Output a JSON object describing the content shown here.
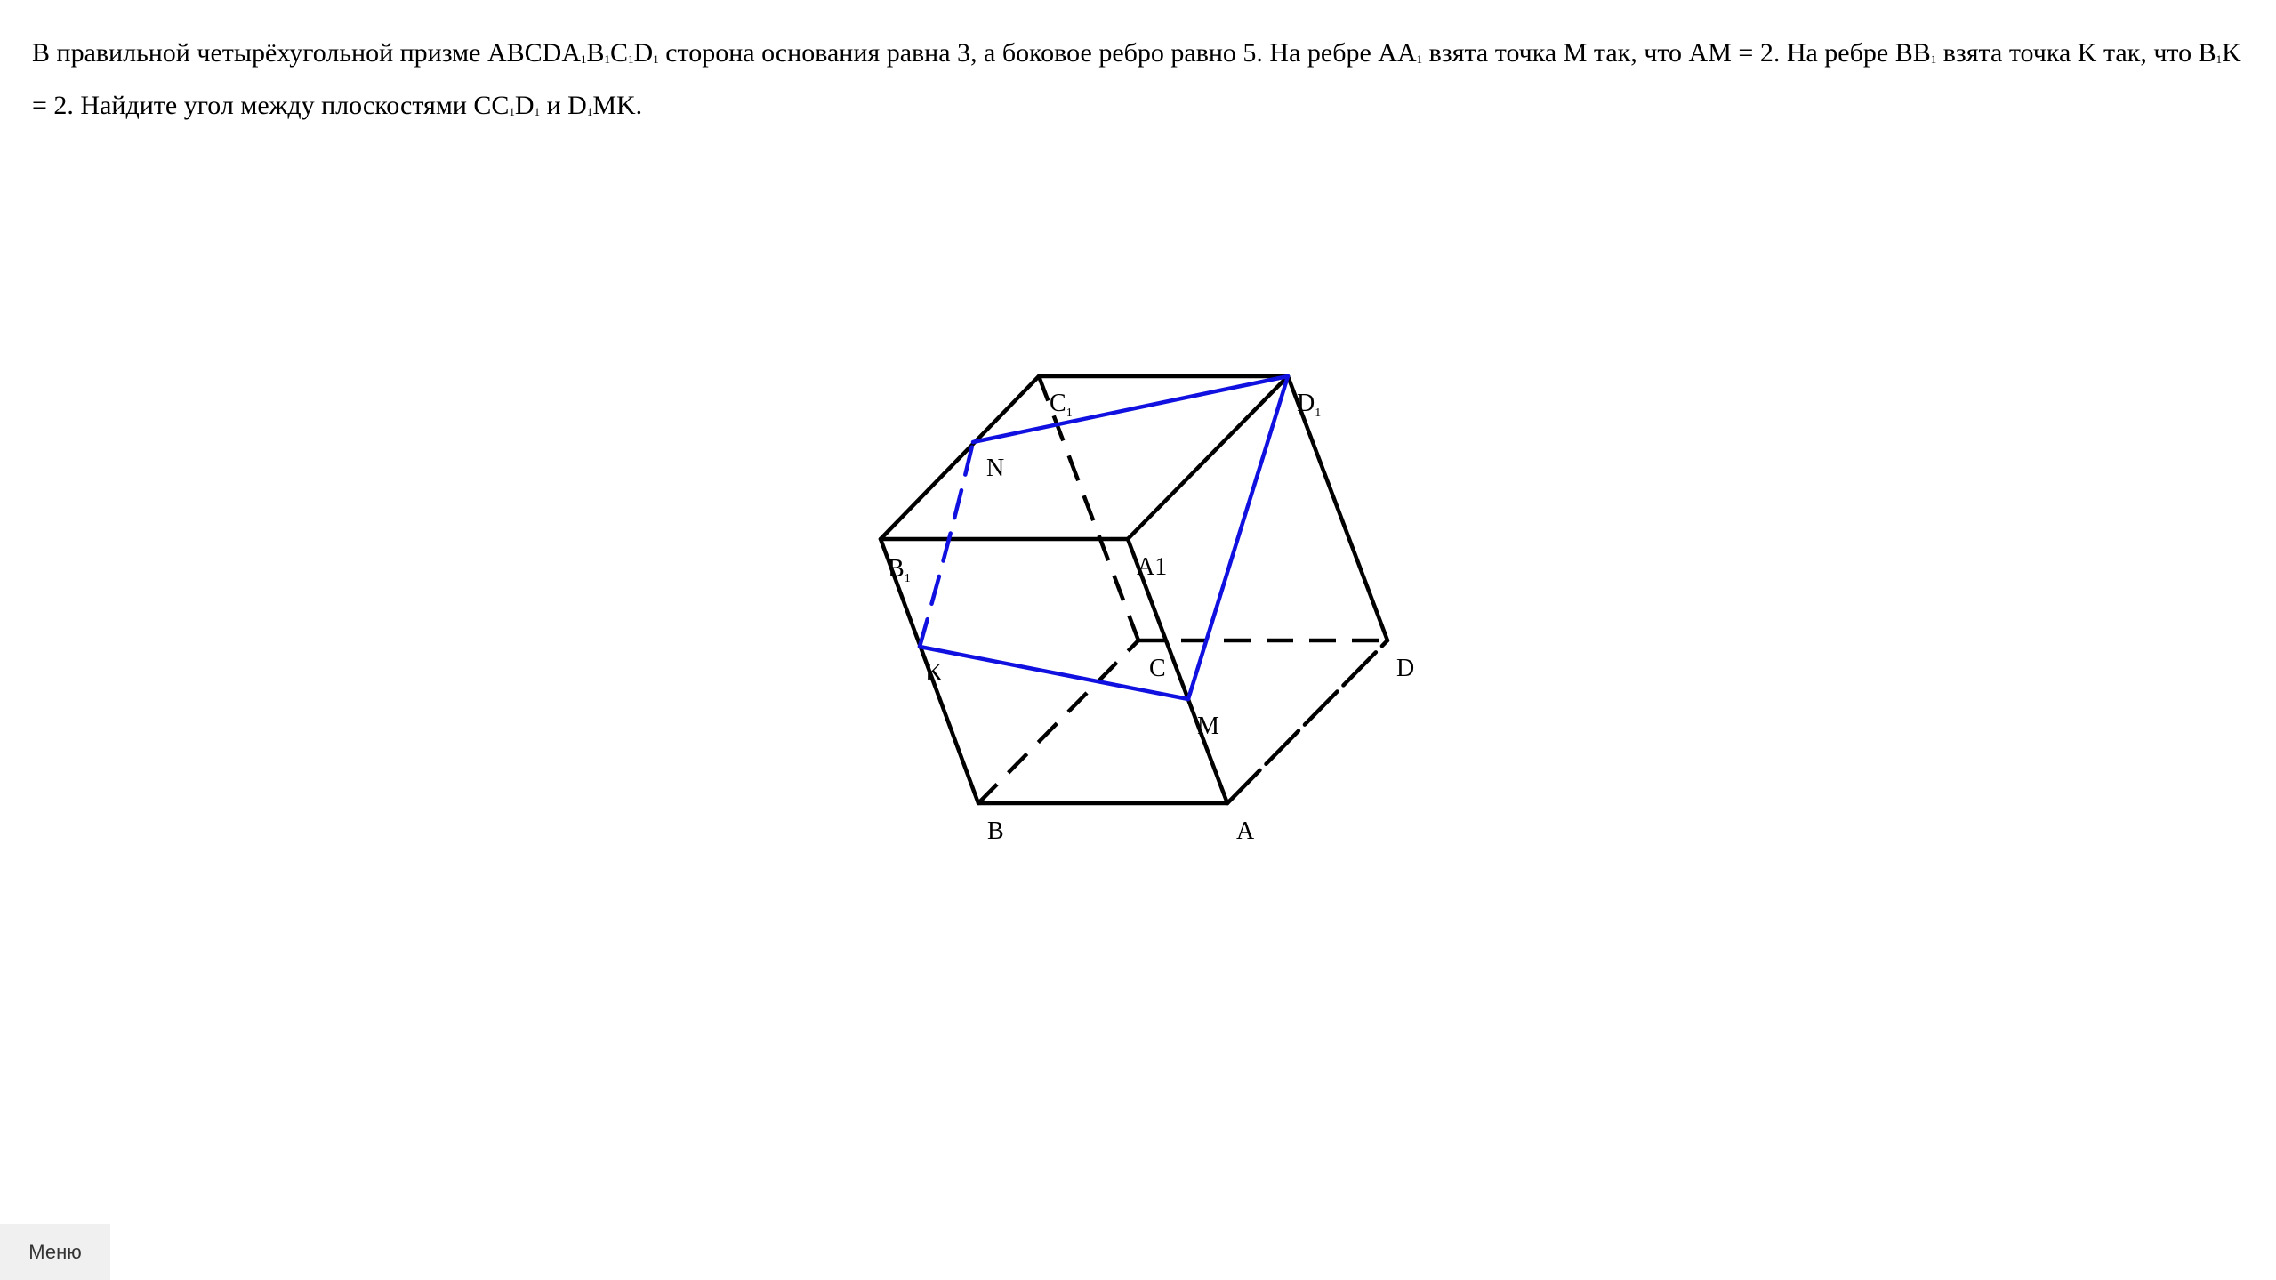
{
  "problem": {
    "p1": "В правильной четырёхугольной призме ABCDA",
    "s1": "1",
    "p2": "B",
    "s2": "1",
    "p3": "C",
    "s3": "1",
    "p4": "D",
    "s4": "1",
    "p5": " сторона основания равна 3, а боковое ребро равно 5. На ребре AA",
    "s5": "1",
    "p6": " взята точка M так, что AM = 2. На ребре BB",
    "s6": "1",
    "p7": " взята точка K так, что B",
    "s7": "1",
    "p8": "K = 2. Найдите угол между плоскостями CC",
    "s8": "1",
    "p9": "D",
    "s9": "1",
    "p10": " и D",
    "s10": "1",
    "p11": "MK."
  },
  "figure": {
    "labels": {
      "c1": "C",
      "c1_sub": "1",
      "d1": "D",
      "d1_sub": "1",
      "n": "N",
      "b1": "B",
      "b1_sub": "1",
      "a1": "A1",
      "k": "K",
      "c": "C",
      "d": "D",
      "m": "M",
      "b": "B",
      "a": "A"
    },
    "colors": {
      "edges": "#000000",
      "section": "#1010e0"
    }
  },
  "menu": {
    "label": "Меню"
  }
}
